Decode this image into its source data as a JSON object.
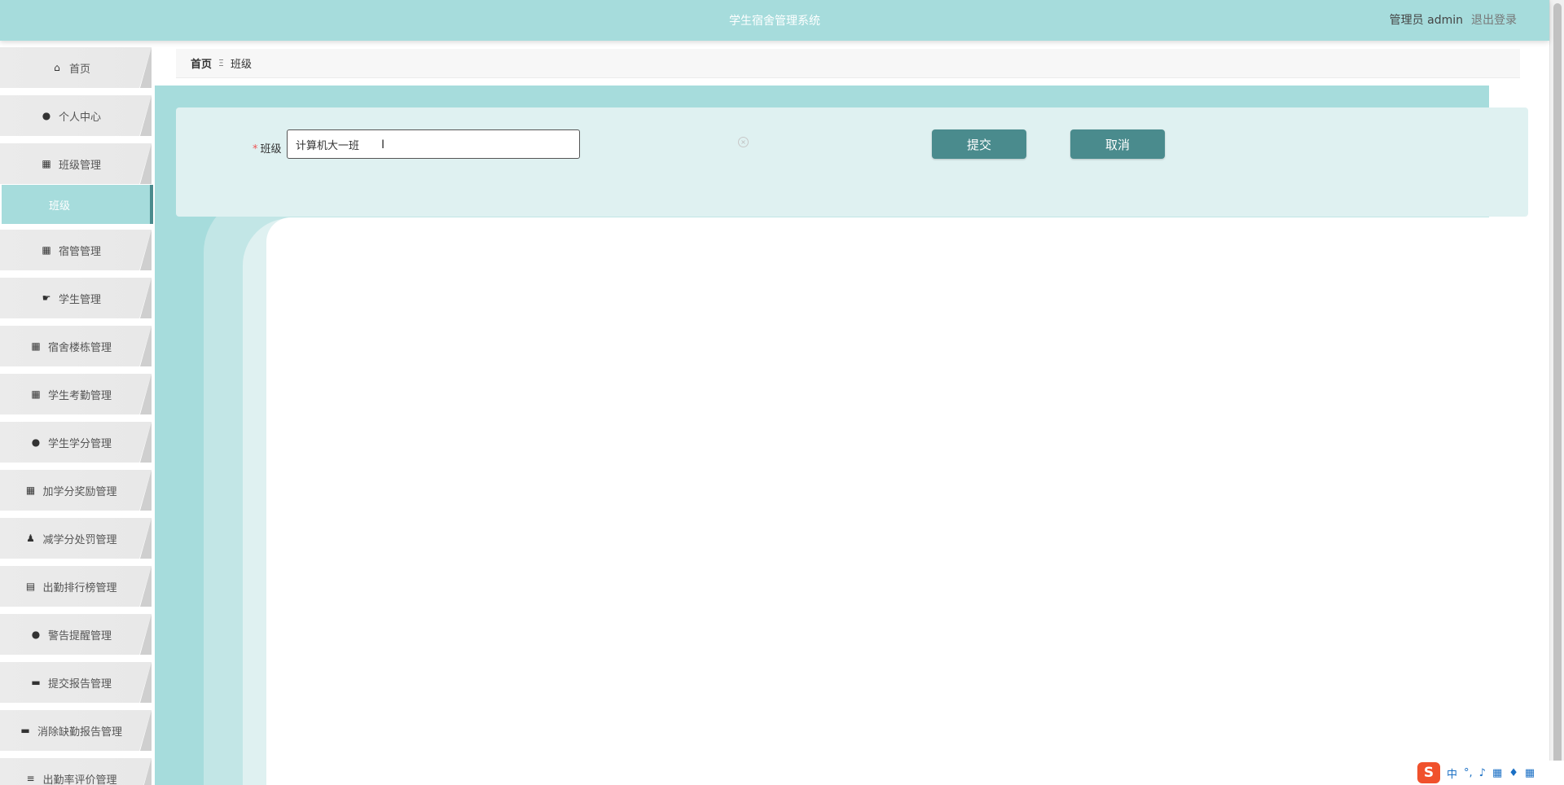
{
  "header": {
    "title": "学生宿舍管理系统",
    "user_label": "管理员 admin",
    "logout_label": "退出登录"
  },
  "sidebar": {
    "items": [
      {
        "label": "首页",
        "icon": "home-icon",
        "glyph": "⌂"
      },
      {
        "label": "个人中心",
        "icon": "user-icon",
        "glyph": "●"
      },
      {
        "label": "班级管理",
        "icon": "grid-icon",
        "glyph": "▦"
      },
      {
        "label": "班级",
        "icon": "",
        "glyph": ""
      },
      {
        "label": "宿管管理",
        "icon": "grid-icon",
        "glyph": "▦"
      },
      {
        "label": "学生管理",
        "icon": "hand-icon",
        "glyph": "☛"
      },
      {
        "label": "宿舍楼栋管理",
        "icon": "grid-icon",
        "glyph": "▦"
      },
      {
        "label": "学生考勤管理",
        "icon": "grid-icon",
        "glyph": "▦"
      },
      {
        "label": "学生学分管理",
        "icon": "bulb-icon",
        "glyph": "●"
      },
      {
        "label": "加学分奖励管理",
        "icon": "grid-icon",
        "glyph": "▦"
      },
      {
        "label": "减学分处罚管理",
        "icon": "person-stamp-icon",
        "glyph": "♟"
      },
      {
        "label": "出勤排行榜管理",
        "icon": "clipboard-icon",
        "glyph": "▤"
      },
      {
        "label": "警告提醒管理",
        "icon": "person-icon",
        "glyph": "●"
      },
      {
        "label": "提交报告管理",
        "icon": "monitor-icon",
        "glyph": "▬"
      },
      {
        "label": "消除缺勤报告管理",
        "icon": "print-icon",
        "glyph": "▬"
      },
      {
        "label": "出勤率评价管理",
        "icon": "sliders-icon",
        "glyph": "≡"
      }
    ]
  },
  "breadcrumb": {
    "home": "首页",
    "separator": "Ξ",
    "current": "班级"
  },
  "form": {
    "field_label": "班级",
    "required_mark": "*",
    "field_value": "计算机大一班",
    "submit_label": "提交",
    "cancel_label": "取消"
  },
  "ime": {
    "logo": "S",
    "mode": "中",
    "punct": "°,"
  },
  "colors": {
    "header": "#a6dcdc",
    "button": "#4a8b8d",
    "panel": "#dff1f1"
  }
}
